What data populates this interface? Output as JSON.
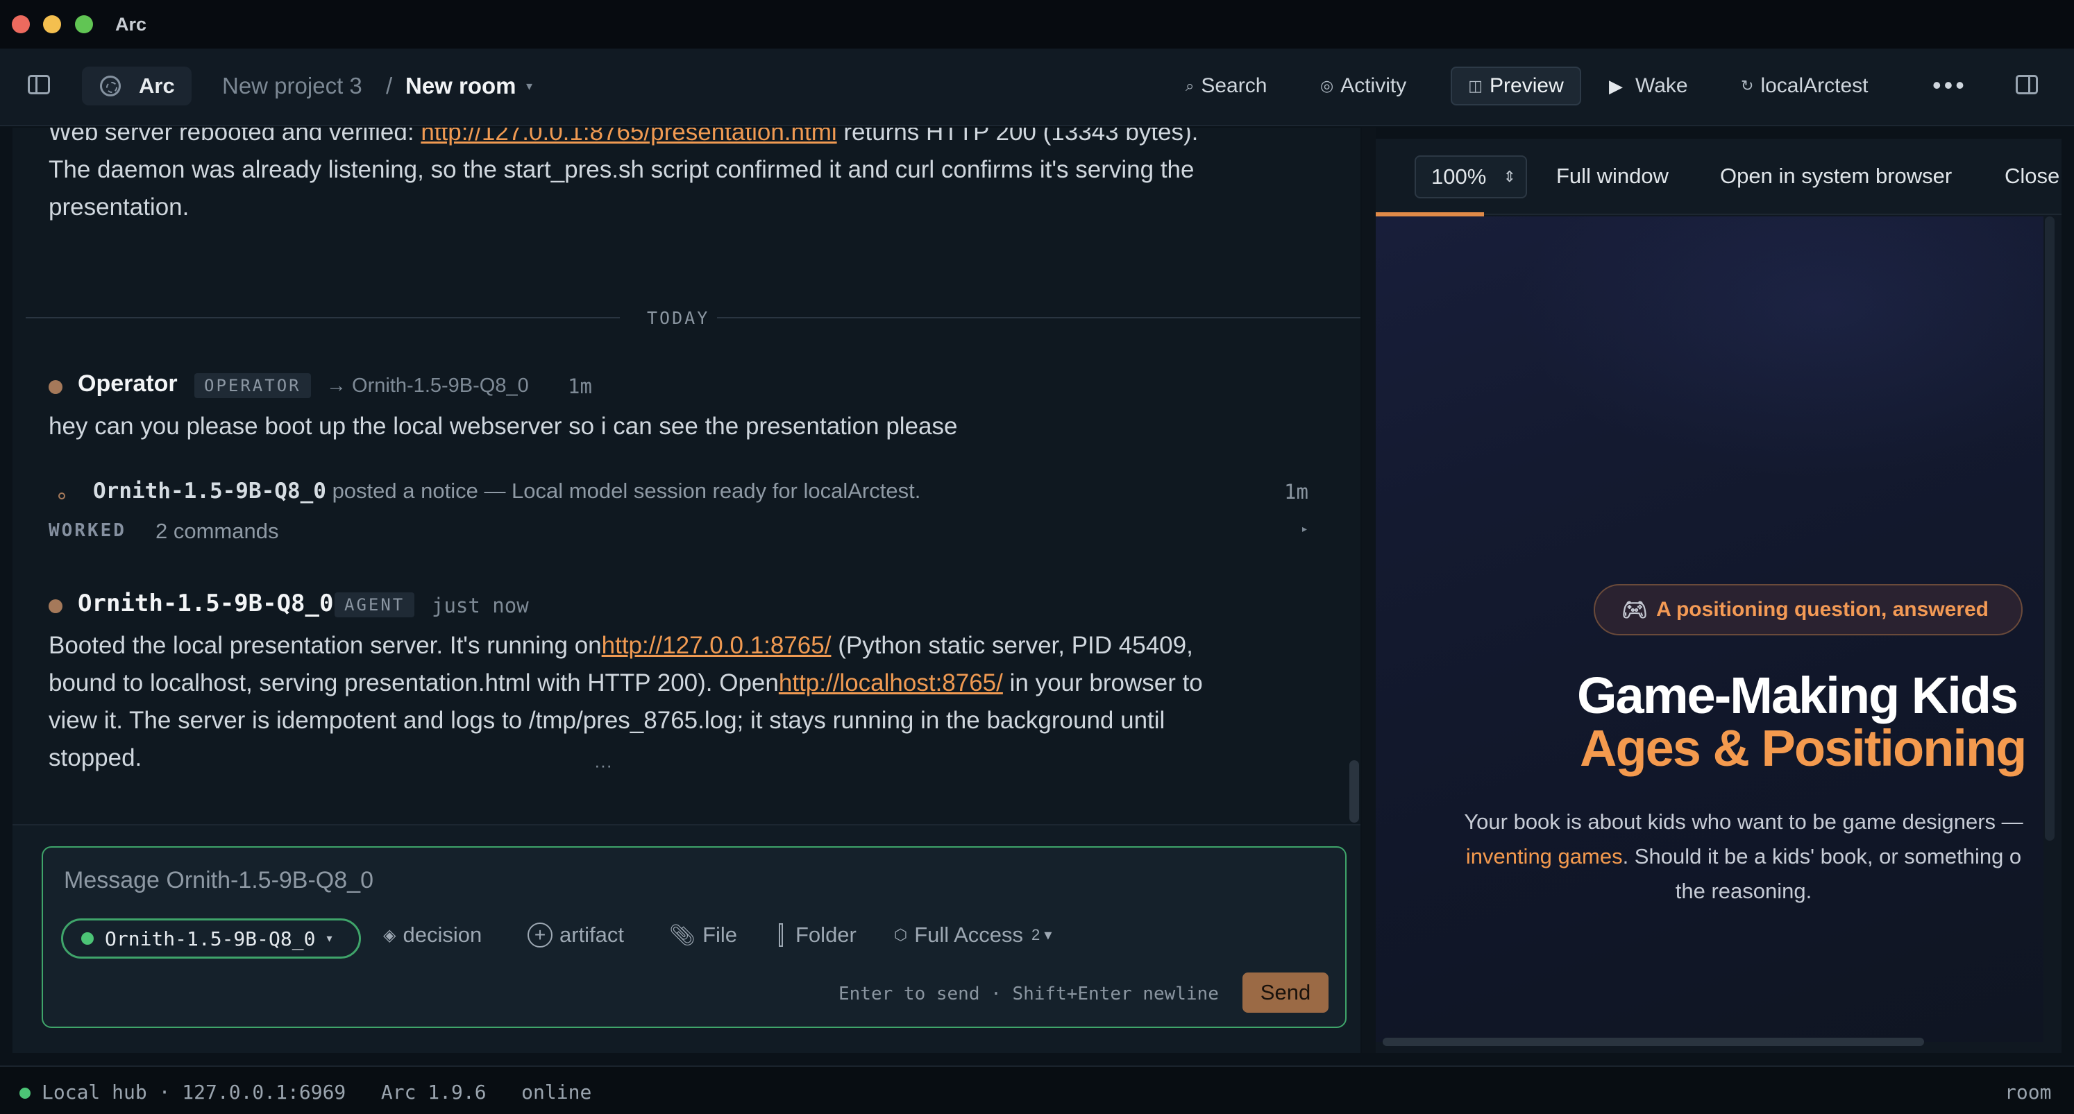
{
  "window": {
    "title": "Arc"
  },
  "topnav": {
    "app_label": "Arc",
    "breadcrumb": {
      "project": "New project 3",
      "separator": "/",
      "room": "New room",
      "caret": "▾"
    },
    "search": "Search",
    "activity": "Activity",
    "preview": "Preview",
    "wake": "Wake",
    "local": "localArctest",
    "more": "•••"
  },
  "chat": {
    "prior_message": {
      "line1_pre": "Web server rebooted and verified: ",
      "line1_link": "http://127.0.0.1:8765/presentation.html",
      "line1_post": " returns HTTP 200 (13343 bytes).",
      "line2": "The daemon was already listening, so the start_pres.sh script confirmed it and curl confirms it's serving the",
      "line3": "presentation."
    },
    "divider": "TODAY",
    "operator_message": {
      "author": "Operator",
      "role": "OPERATOR",
      "target": "→ Ornith-1.5-9B-Q8_0",
      "time": "1m",
      "text": "hey can you please boot up the local webserver so i can see the presentation please"
    },
    "notice": {
      "author": "Ornith-1.5-9B-Q8_0",
      "text": " posted a notice — Local model session ready for localArctest.",
      "time": "1m"
    },
    "worked": {
      "label": "WORKED",
      "count": "2 commands",
      "caret": "▸"
    },
    "agent_message": {
      "author": "Ornith-1.5-9B-Q8_0",
      "role": "AGENT",
      "time": "just now",
      "line1_pre": "Booted the local presentation server. It's running on",
      "link1": "http://127.0.0.1:8765/",
      "line1_post": " (Python static server, PID 45409,",
      "line2_pre": "bound to localhost, serving presentation.html with HTTP 200). Open",
      "link2": "http://localhost:8765/",
      "line2_post": " in your browser to",
      "line3": "view it. The server is idempotent and logs to /tmp/pres_8765.log; it stays running in the background until",
      "line4": "stopped."
    },
    "ellipsis": "···"
  },
  "composer": {
    "placeholder": "Message Ornith-1.5-9B-Q8_0",
    "agent": "Ornith-1.5-9B-Q8_0",
    "agent_caret": "▾",
    "decision": "decision",
    "artifact": "artifact",
    "file": "File",
    "folder": "Folder",
    "access": "Full Access",
    "access_count": "2 ▾",
    "hint": "Enter to send · Shift+Enter newline",
    "send": "Send"
  },
  "preview": {
    "zoom": "100%",
    "full_window": "Full window",
    "open_system": "Open in system browser",
    "close": "Close",
    "slide": {
      "pill": "A positioning question, answered",
      "title1": "Game-Making Kids",
      "title2": "Ages & Positioning",
      "body1": "Your book is about kids who want to be game designers —",
      "body2_hl": "inventing games",
      "body2": ". Should it be a kids' book, or something o",
      "body3": "the reasoning."
    }
  },
  "status": {
    "left": "Local hub · 127.0.0.1:6969   Arc 1.9.6   online",
    "right": "room"
  },
  "colors": {
    "accent": "#f09a52",
    "online": "#4cc476",
    "composer_border": "#3fa46a",
    "send": "#9b6a45"
  }
}
